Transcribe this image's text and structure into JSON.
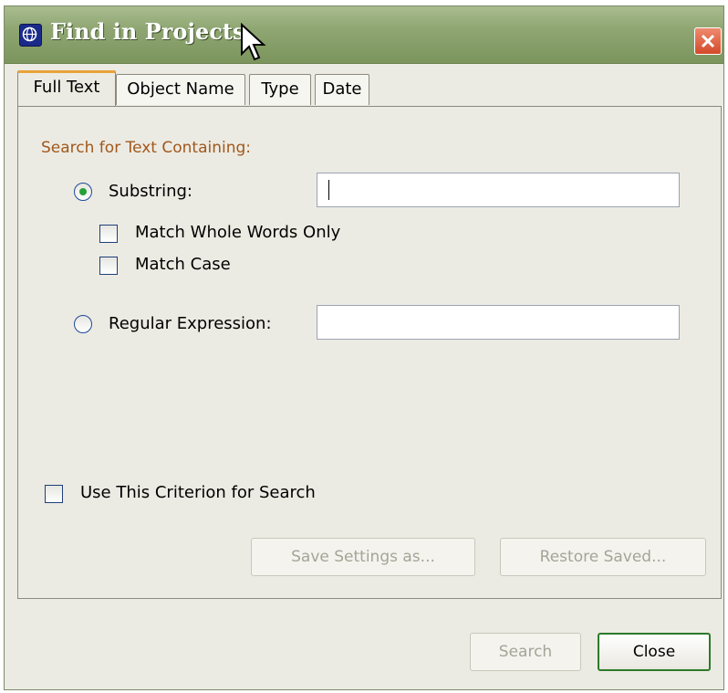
{
  "window": {
    "title": "Find in Projects",
    "app_icon": "globe-icon",
    "close_icon": "close-icon"
  },
  "tabs": [
    {
      "label": "Full Text",
      "active": true
    },
    {
      "label": "Object Name",
      "active": false
    },
    {
      "label": "Type",
      "active": false
    },
    {
      "label": "Date",
      "active": false
    }
  ],
  "full_text": {
    "section_label": "Search for Text Containing:",
    "substring": {
      "label": "Substring:",
      "selected": true,
      "value": ""
    },
    "match_whole_words": {
      "label": "Match Whole Words Only",
      "checked": false
    },
    "match_case": {
      "label": "Match Case",
      "checked": false
    },
    "regex": {
      "label": "Regular Expression:",
      "selected": false,
      "value": ""
    },
    "use_criterion": {
      "label": "Use This Criterion for Search",
      "checked": false
    }
  },
  "buttons": {
    "save_settings": "Save Settings as...",
    "restore_saved": "Restore Saved...",
    "search": "Search",
    "close": "Close"
  },
  "colors": {
    "title_bar": "#8fa672",
    "section_label": "#a0581c",
    "default_button_border": "#2d7a2a",
    "radio_dot": "#27a13a"
  }
}
